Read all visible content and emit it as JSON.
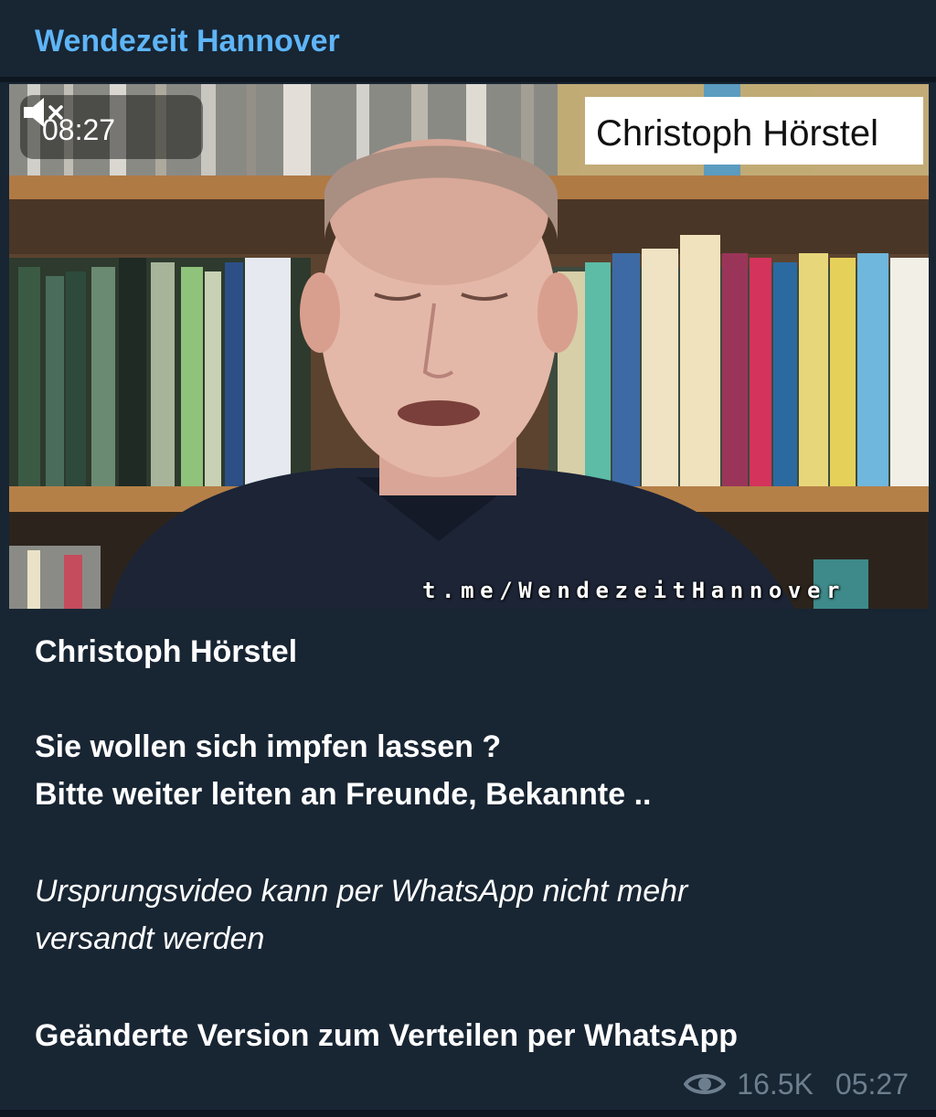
{
  "channel": {
    "name": "Wendezeit Hannover"
  },
  "video": {
    "duration": "08:27",
    "muted_icon": "speaker-muted-icon",
    "overlay_name": "Christoph Hörstel",
    "watermark": "t.me/WendezeitHannover"
  },
  "caption": {
    "line1": "Christoph Hörstel",
    "line2": "Sie wollen sich impfen lassen ?",
    "line3": "Bitte weiter leiten an Freunde, Bekannte ..",
    "line4": "Ursprungsvideo kann per WhatsApp nicht mehr",
    "line5": "versandt werden",
    "line6": "Geänderte Version zum Verteilen per WhatsApp"
  },
  "meta": {
    "views_icon": "eye-icon",
    "views": "16.5K",
    "time": "05:27"
  },
  "colors": {
    "background": "#182533",
    "accent": "#5eb5f7",
    "meta": "#6d7f8f"
  }
}
